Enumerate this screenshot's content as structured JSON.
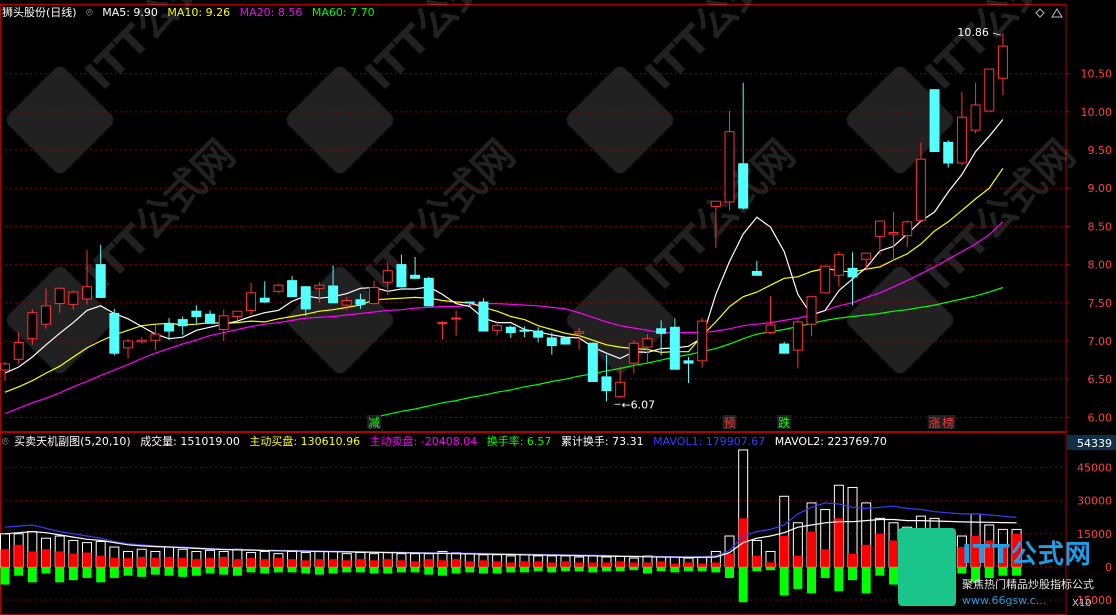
{
  "header": {
    "title": "狮头股份(日线)",
    "ma5": "MA5: 9.90",
    "ma10": "MA10: 9.26",
    "ma20": "MA20: 8.56",
    "ma60": "MA60: 7.70"
  },
  "sub_header": {
    "title": "买卖天机副图(5,20,10)",
    "volume": "成交量: 151019.00",
    "active_buy": "主动买盘: 130610.96",
    "active_sell": "主动卖盘: -20408.04",
    "turnover": "换手率: 6.57",
    "cum_turnover": "累计换手: 73.31",
    "mavol1": "MAVOL1: 179907.67",
    "mavol2": "MAVOL2: 223769.70"
  },
  "colors": {
    "up": "#ff3232",
    "down": "#54ffff",
    "ma5": "#ffffff",
    "ma10": "#ffff00",
    "ma20": "#ff00ff",
    "ma60": "#00ff00",
    "grid": "#8b0000",
    "sell": "#00ff00",
    "buy": "#ff0000",
    "mavol1": "#3a3aff"
  },
  "watermark": {
    "text": "ITT公式网"
  },
  "logo": {
    "name": "ITT公式网",
    "tagline": "聚焦热门精品炒股指标公式",
    "url": "www.66gsw.c...",
    "scale": "X10"
  },
  "chart_data": [
    {
      "type": "candlestick",
      "title": "狮头股份(日线)",
      "ylim": [
        5.9,
        11.15
      ],
      "y_ticks": [
        "10.50",
        "10.00",
        "9.50",
        "9.00",
        "8.50",
        "8.00",
        "7.50",
        "7.00",
        "6.50",
        "6.00"
      ],
      "annotations": {
        "high": "10.86",
        "low": "6.07"
      },
      "markers": [
        "减",
        "预",
        "跌",
        "涨",
        "榜"
      ],
      "ohlc": [
        [
          6.62,
          6.73,
          6.48,
          6.7
        ],
        [
          6.76,
          7.11,
          6.7,
          6.98
        ],
        [
          7.03,
          7.42,
          6.95,
          7.37
        ],
        [
          7.22,
          7.69,
          7.16,
          7.46
        ],
        [
          7.49,
          7.7,
          7.37,
          7.69
        ],
        [
          7.48,
          7.66,
          7.41,
          7.64
        ],
        [
          7.55,
          8.19,
          7.48,
          7.71
        ],
        [
          8.0,
          8.26,
          7.57,
          7.57
        ],
        [
          7.36,
          7.42,
          6.81,
          6.84
        ],
        [
          6.91,
          7.03,
          6.77,
          7.0
        ],
        [
          6.99,
          7.05,
          6.97,
          7.01
        ],
        [
          7.01,
          7.21,
          6.88,
          7.09
        ],
        [
          7.23,
          7.3,
          7.01,
          7.13
        ],
        [
          7.28,
          7.32,
          7.08,
          7.2
        ],
        [
          7.39,
          7.47,
          7.23,
          7.32
        ],
        [
          7.35,
          7.4,
          7.23,
          7.23
        ],
        [
          7.15,
          7.41,
          7.0,
          7.33
        ],
        [
          7.32,
          7.38,
          7.27,
          7.39
        ],
        [
          7.4,
          7.76,
          7.34,
          7.63
        ],
        [
          7.56,
          7.78,
          7.5,
          7.51
        ],
        [
          7.65,
          7.75,
          7.63,
          7.73
        ],
        [
          7.79,
          7.85,
          7.67,
          7.58
        ],
        [
          7.71,
          7.72,
          7.33,
          7.42
        ],
        [
          7.69,
          7.77,
          7.5,
          7.73
        ],
        [
          7.72,
          7.99,
          7.63,
          7.5
        ],
        [
          7.47,
          7.57,
          7.4,
          7.53
        ],
        [
          7.54,
          7.62,
          7.42,
          7.48
        ],
        [
          7.49,
          7.79,
          7.48,
          7.7
        ],
        [
          7.77,
          8.03,
          7.6,
          7.92
        ],
        [
          8.0,
          8.13,
          7.7,
          7.71
        ],
        [
          7.86,
          8.1,
          7.81,
          7.82
        ],
        [
          7.82,
          7.84,
          7.6,
          7.46
        ],
        [
          7.23,
          7.26,
          7.02,
          7.24
        ],
        [
          7.29,
          7.4,
          7.07,
          7.3
        ],
        [
          7.51,
          7.51,
          7.45,
          7.5
        ],
        [
          7.51,
          7.56,
          7.32,
          7.13
        ],
        [
          7.14,
          7.26,
          7.07,
          7.2
        ],
        [
          7.18,
          7.2,
          7.04,
          7.11
        ],
        [
          7.14,
          7.19,
          7.05,
          7.13
        ],
        [
          7.13,
          7.18,
          6.98,
          7.05
        ],
        [
          7.04,
          7.11,
          6.82,
          6.94
        ],
        [
          7.04,
          7.05,
          6.99,
          6.96
        ],
        [
          7.1,
          7.17,
          6.89,
          7.12
        ],
        [
          6.97,
          6.98,
          6.56,
          6.47
        ],
        [
          6.53,
          6.82,
          6.21,
          6.35
        ],
        [
          6.27,
          6.66,
          6.25,
          6.46
        ],
        [
          6.71,
          7.01,
          6.57,
          6.97
        ],
        [
          6.92,
          7.09,
          6.7,
          7.03
        ],
        [
          7.16,
          7.27,
          6.81,
          7.1
        ],
        [
          7.18,
          7.3,
          6.84,
          6.63
        ],
        [
          6.74,
          6.79,
          6.45,
          6.71
        ],
        [
          6.74,
          7.3,
          6.65,
          7.26
        ],
        [
          8.76,
          8.83,
          8.22,
          8.83
        ],
        [
          8.82,
          10.01,
          8.71,
          9.74
        ],
        [
          9.32,
          10.38,
          8.72,
          8.74
        ],
        [
          7.91,
          8.05,
          7.91,
          7.86
        ],
        [
          7.11,
          7.59,
          7.09,
          7.21
        ],
        [
          6.96,
          6.99,
          6.84,
          6.84
        ],
        [
          6.88,
          7.27,
          6.64,
          7.25
        ],
        [
          7.22,
          7.47,
          7.06,
          7.58
        ],
        [
          7.63,
          7.99,
          7.63,
          7.98
        ],
        [
          7.86,
          8.17,
          7.71,
          8.13
        ],
        [
          7.95,
          8.16,
          7.47,
          7.84
        ],
        [
          8.07,
          8.15,
          7.94,
          8.15
        ],
        [
          8.37,
          8.58,
          8.13,
          8.57
        ],
        [
          8.4,
          8.69,
          8.05,
          8.42
        ],
        [
          8.38,
          8.58,
          8.23,
          8.56
        ],
        [
          8.58,
          9.6,
          8.55,
          9.38
        ],
        [
          10.29,
          10.29,
          9.48,
          9.48
        ],
        [
          9.6,
          9.63,
          9.27,
          9.33
        ],
        [
          9.33,
          10.26,
          9.3,
          9.93
        ],
        [
          9.76,
          10.38,
          9.72,
          10.09
        ],
        [
          10.01,
          10.45,
          10.01,
          10.56
        ],
        [
          10.44,
          11.03,
          10.22,
          10.86
        ]
      ],
      "ma5": [
        6.58,
        6.66,
        6.79,
        6.95,
        7.1,
        7.24,
        7.4,
        7.46,
        7.36,
        7.29,
        7.19,
        7.09,
        7.03,
        7.05,
        7.14,
        7.18,
        7.22,
        7.26,
        7.32,
        7.37,
        7.4,
        7.52,
        7.59,
        7.56,
        7.58,
        7.62,
        7.69,
        7.7,
        7.65,
        7.68,
        7.68,
        7.71,
        7.61,
        7.49,
        7.45,
        7.3,
        7.24,
        7.24,
        7.15,
        7.12,
        7.08,
        7.05,
        7.04,
        6.92,
        6.84,
        6.77,
        6.86,
        6.85,
        6.9,
        6.91,
        6.93,
        7.04,
        7.61,
        8.04,
        8.4,
        8.62,
        8.49,
        8.17,
        7.61,
        7.34,
        7.4,
        7.66,
        7.81,
        7.96,
        8.18,
        8.24,
        8.4,
        8.57,
        8.69,
        8.95,
        9.18,
        9.48,
        9.68,
        9.9
      ],
      "ma10": [
        6.33,
        6.4,
        6.48,
        6.58,
        6.67,
        6.79,
        6.91,
        7.0,
        7.08,
        7.14,
        7.2,
        7.22,
        7.23,
        7.21,
        7.22,
        7.24,
        7.23,
        7.24,
        7.26,
        7.25,
        7.29,
        7.32,
        7.35,
        7.39,
        7.41,
        7.44,
        7.47,
        7.54,
        7.55,
        7.56,
        7.57,
        7.56,
        7.53,
        7.51,
        7.5,
        7.44,
        7.39,
        7.32,
        7.28,
        7.2,
        7.15,
        7.1,
        7.07,
        7.01,
        6.95,
        6.92,
        6.9,
        6.89,
        6.85,
        6.86,
        6.86,
        7.07,
        7.25,
        7.45,
        7.58,
        7.64,
        7.73,
        7.82,
        7.84,
        7.91,
        7.95,
        7.92,
        7.9,
        7.94,
        7.97,
        8.06,
        8.14,
        8.27,
        8.44,
        8.56,
        8.71,
        8.86,
        9.0,
        9.26
      ],
      "ma20": [
        6.05,
        6.12,
        6.19,
        6.25,
        6.32,
        6.4,
        6.47,
        6.55,
        6.62,
        6.69,
        6.77,
        6.84,
        6.9,
        6.96,
        7.01,
        7.07,
        7.11,
        7.15,
        7.19,
        7.22,
        7.24,
        7.27,
        7.3,
        7.31,
        7.32,
        7.34,
        7.36,
        7.38,
        7.4,
        7.41,
        7.43,
        7.44,
        7.45,
        7.45,
        7.47,
        7.49,
        7.49,
        7.48,
        7.47,
        7.46,
        7.44,
        7.42,
        7.37,
        7.31,
        7.25,
        7.2,
        7.17,
        7.14,
        7.11,
        7.11,
        7.11,
        7.11,
        7.13,
        7.16,
        7.2,
        7.22,
        7.24,
        7.27,
        7.3,
        7.34,
        7.4,
        7.46,
        7.5,
        7.57,
        7.63,
        7.71,
        7.79,
        7.88,
        7.97,
        8.07,
        8.17,
        8.27,
        8.39,
        8.56
      ],
      "ma60": [
        null,
        null,
        null,
        null,
        null,
        null,
        null,
        null,
        null,
        null,
        null,
        null,
        null,
        null,
        null,
        null,
        null,
        null,
        null,
        null,
        null,
        null,
        null,
        null,
        null,
        null,
        null,
        6.0,
        6.04,
        6.08,
        6.11,
        6.15,
        6.19,
        6.22,
        6.26,
        6.29,
        6.33,
        6.36,
        6.4,
        6.43,
        6.47,
        6.5,
        6.54,
        6.57,
        6.61,
        6.64,
        6.68,
        6.71,
        6.75,
        6.79,
        6.82,
        6.86,
        6.9,
        6.96,
        7.03,
        7.09,
        7.12,
        7.15,
        7.19,
        7.23,
        7.27,
        7.3,
        7.32,
        7.34,
        7.36,
        7.39,
        7.41,
        7.44,
        7.47,
        7.51,
        7.55,
        7.59,
        7.64,
        7.7
      ]
    },
    {
      "type": "bar",
      "title": "买卖天机副图(5,20,10)",
      "ylim": [
        -15000,
        54339
      ],
      "y_ticks": [
        "54339",
        "45000",
        "30000",
        "15000",
        "0",
        "15000"
      ],
      "volume": [
        15000,
        15000,
        16000,
        13000,
        14000,
        12000,
        11000,
        11500,
        9000,
        7000,
        8000,
        7000,
        9000,
        8000,
        7000,
        7500,
        7000,
        8000,
        6500,
        7000,
        6000,
        7000,
        6500,
        7000,
        7000,
        6000,
        6500,
        6000,
        6500,
        6000,
        6000,
        6000,
        7000,
        6500,
        6000,
        5500,
        5500,
        5000,
        5500,
        5000,
        5000,
        5000,
        4500,
        5000,
        4500,
        4800,
        4000,
        5000,
        4500,
        4500,
        4000,
        4500,
        7000,
        14000,
        53000,
        12000,
        7000,
        32000,
        20000,
        29000,
        26000,
        37000,
        36000,
        29000,
        22000,
        20000,
        18000,
        23000,
        22000,
        15000,
        14000,
        24000,
        19000,
        17000,
        17000
      ],
      "buy": [
        8000,
        10000,
        7000,
        8000,
        7000,
        6000,
        6500,
        5000,
        4000,
        4000,
        4500,
        4000,
        4500,
        4000,
        3500,
        4000,
        4500,
        3500,
        4000,
        3500,
        4000,
        3500,
        3000,
        3500,
        3500,
        3000,
        3500,
        3000,
        3500,
        3000,
        2500,
        3500,
        3000,
        3500,
        2500,
        3000,
        2500,
        2000,
        2500,
        2500,
        2000,
        2500,
        2000,
        2000,
        2000,
        2500,
        2000,
        2000,
        2500,
        1500,
        2000,
        1500,
        2000,
        6000,
        22000,
        5000,
        2000,
        14000,
        5000,
        16000,
        8000,
        22000,
        6000,
        10000,
        15000,
        12000,
        8000,
        14000,
        11000,
        10000,
        9000,
        14000,
        12000,
        10000,
        15000
      ],
      "sell": [
        -8000,
        -4000,
        -7000,
        -3000,
        -7000,
        -6000,
        -5000,
        -7000,
        -5000,
        -4000,
        -4500,
        -3500,
        -4000,
        -4500,
        -4000,
        -3000,
        -3500,
        -4000,
        -2500,
        -3000,
        -2500,
        -2500,
        -3000,
        -3500,
        -3000,
        -2500,
        -2500,
        -3000,
        -3000,
        -2500,
        -2500,
        -3500,
        -4000,
        -3000,
        -2500,
        -3000,
        -3000,
        -2500,
        -2500,
        -2000,
        -2500,
        -2000,
        -2000,
        -2500,
        -2000,
        -2000,
        -1500,
        -3000,
        -2000,
        -2500,
        -2000,
        -2000,
        -2500,
        -5000,
        -16000,
        -2000,
        -1500,
        -13000,
        -10000,
        -12000,
        -5000,
        -11000,
        -6000,
        -12000,
        -4000,
        -8000,
        -10000,
        -7000,
        -4000,
        -6000,
        -3000,
        -7000,
        -5000,
        -4000,
        -4000
      ],
      "mavol1": [
        18000,
        18500,
        19000,
        17500,
        16000,
        15000,
        14000,
        13000,
        11500,
        10500,
        10000,
        9500,
        9000,
        9000,
        8600,
        8300,
        8000,
        7900,
        7800,
        7600,
        7500,
        7400,
        7300,
        7200,
        7100,
        7000,
        6900,
        6800,
        6700,
        6600,
        6500,
        6400,
        6400,
        6300,
        6200,
        6100,
        6000,
        5900,
        5800,
        5700,
        5600,
        5500,
        5400,
        5300,
        5200,
        5000,
        4900,
        4800,
        4700,
        4650,
        4600,
        4700,
        5000,
        7500,
        14000,
        16000,
        17000,
        19000,
        24000,
        27000,
        29000,
        28500,
        27000,
        26500,
        27000,
        27500,
        26500,
        26000,
        25000,
        24500,
        24000,
        24000,
        23500,
        23000,
        22377
      ],
      "mavol2": [
        15000,
        15500,
        16000,
        15500,
        14500,
        13500,
        12500,
        12000,
        11000,
        10000,
        9500,
        9200,
        9000,
        8700,
        8400,
        8100,
        7900,
        7700,
        7600,
        7400,
        7300,
        7200,
        7100,
        7000,
        6900,
        6800,
        6700,
        6600,
        6500,
        6400,
        6300,
        6200,
        6100,
        6000,
        5900,
        5800,
        5700,
        5600,
        5500,
        5400,
        5300,
        5200,
        5100,
        5000,
        4900,
        4800,
        4700,
        4600,
        4500,
        4400,
        4300,
        4300,
        4500,
        6500,
        11000,
        13000,
        14000,
        15500,
        18000,
        19000,
        20000,
        20500,
        20500,
        21000,
        21500,
        21500,
        21000,
        21000,
        20800,
        20600,
        20400,
        20300,
        20200,
        20100,
        20000
      ]
    }
  ]
}
